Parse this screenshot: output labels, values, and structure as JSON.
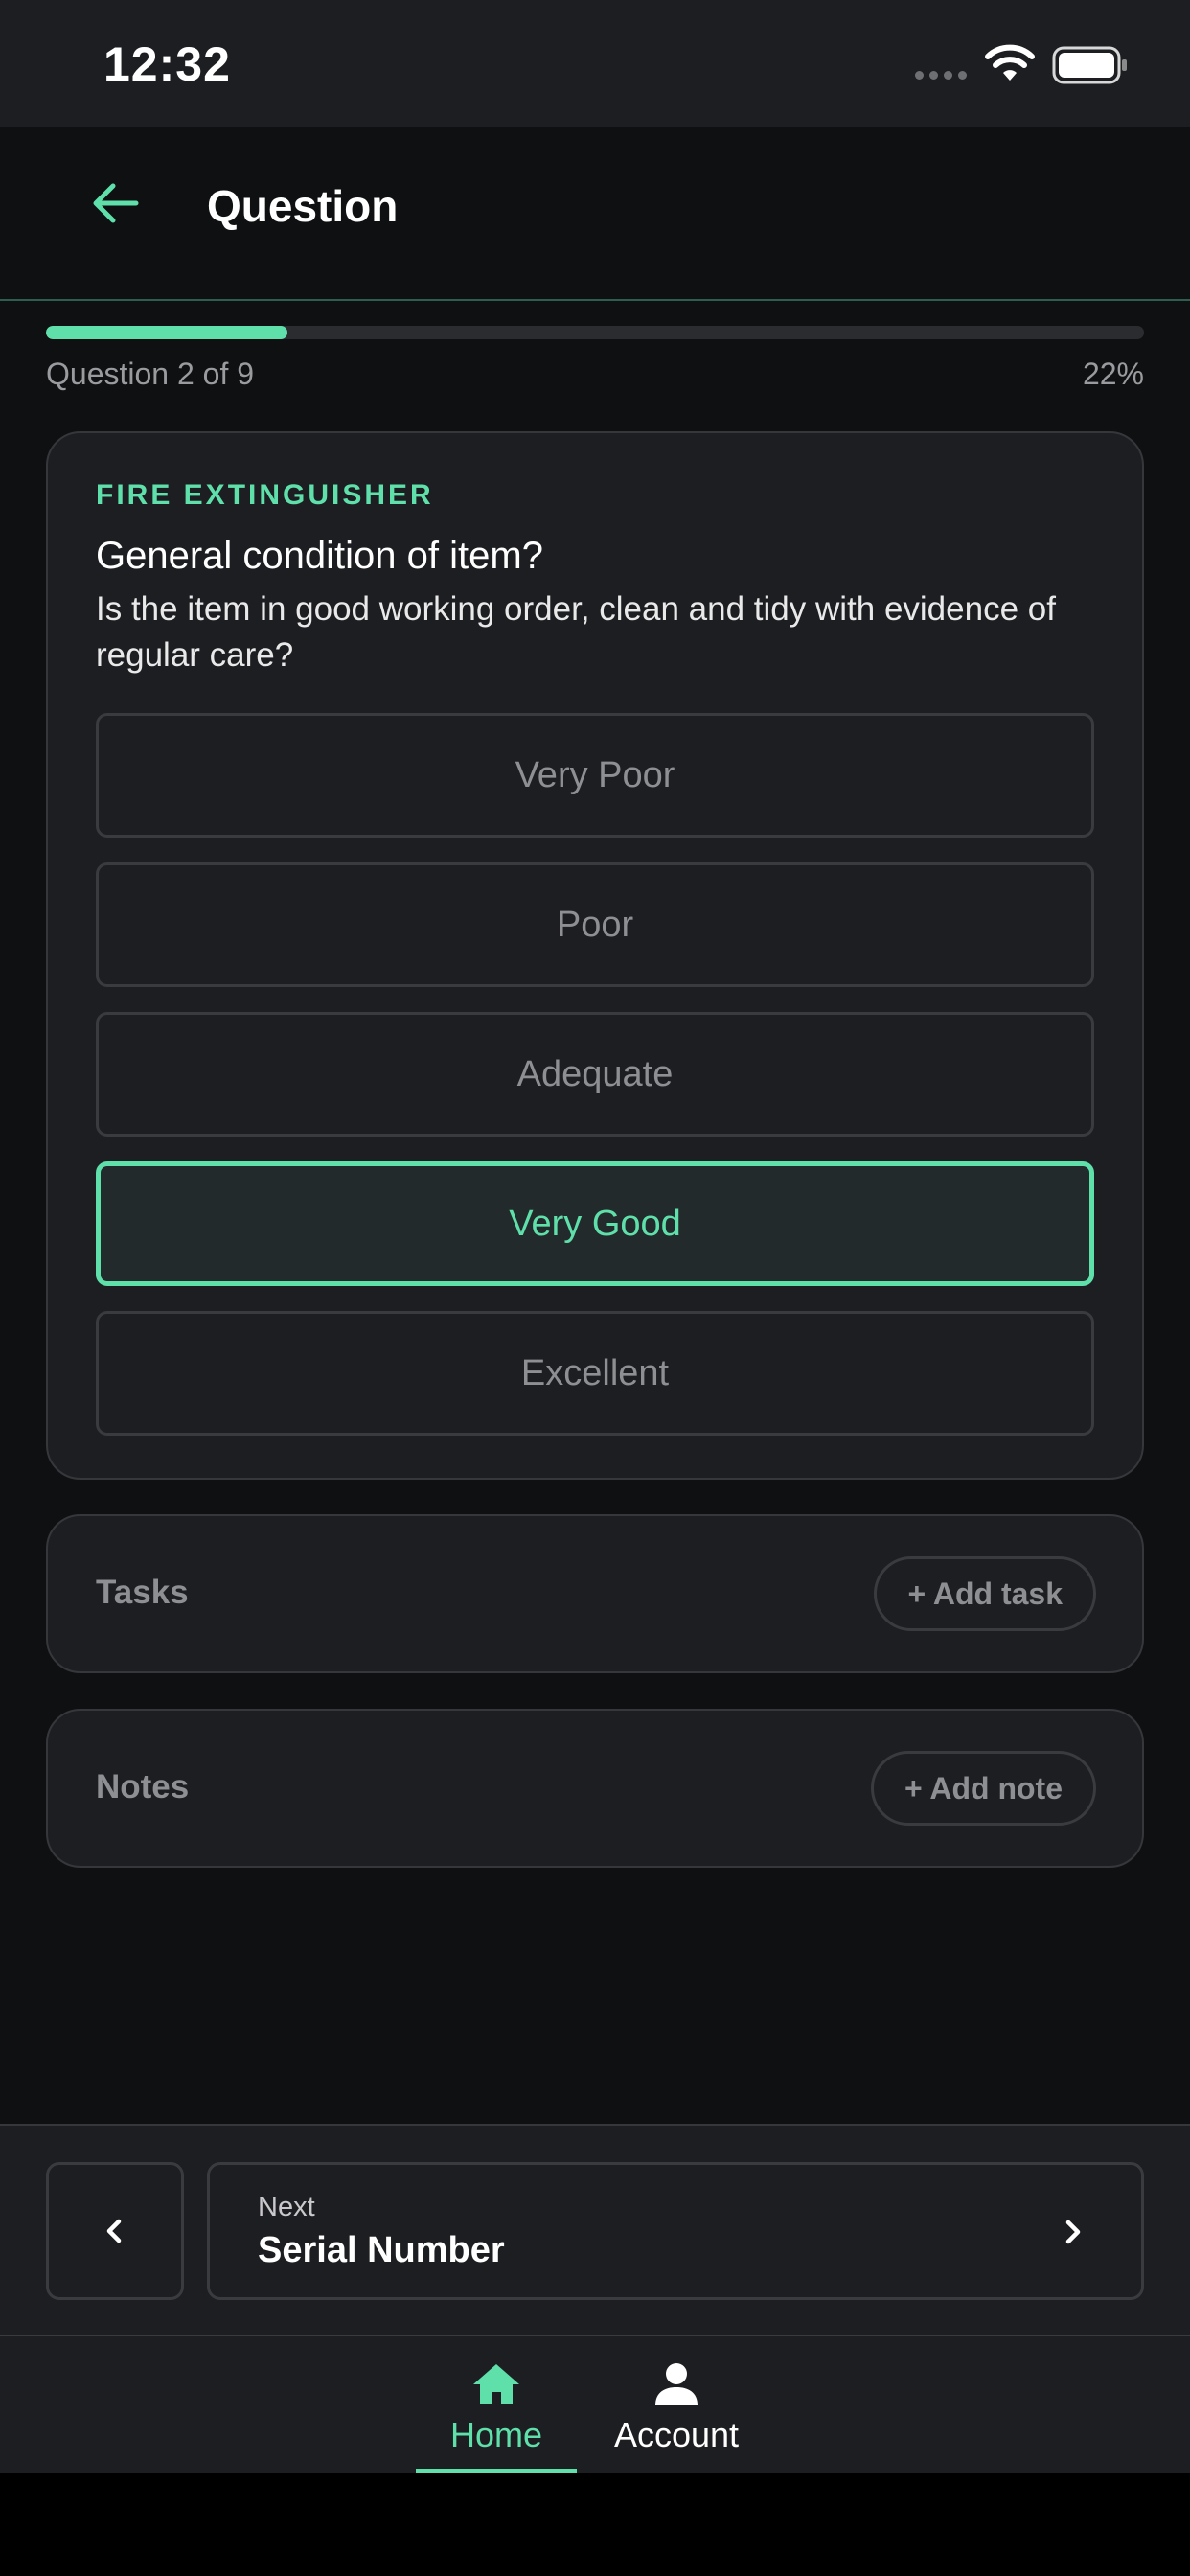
{
  "status_bar": {
    "time": "12:32"
  },
  "header": {
    "title": "Question"
  },
  "progress": {
    "label": "Question 2 of 9",
    "percent_text": "22%",
    "fraction": 0.22
  },
  "question": {
    "category": "FIRE EXTINGUISHER",
    "title": "General condition of item?",
    "description": "Is the item in good working order, clean and tidy with evidence of regular care?",
    "options": [
      {
        "label": "Very Poor",
        "selected": false
      },
      {
        "label": "Poor",
        "selected": false
      },
      {
        "label": "Adequate",
        "selected": false
      },
      {
        "label": "Very Good",
        "selected": true
      },
      {
        "label": "Excellent",
        "selected": false
      }
    ]
  },
  "tasks": {
    "label": "Tasks",
    "add_label": "+ Add task"
  },
  "notes": {
    "label": "Notes",
    "add_label": "+ Add note"
  },
  "navigation": {
    "next_caption": "Next",
    "next_title": "Serial Number"
  },
  "tab_bar": {
    "items": [
      {
        "label": "Home",
        "icon": "home-icon",
        "active": true
      },
      {
        "label": "Account",
        "icon": "person-icon",
        "active": false
      }
    ]
  },
  "colors": {
    "accent": "#5fe0ab",
    "background": "#0f1012",
    "surface": "#1d1e21",
    "border": "#3a3b3e",
    "muted_text": "#8e8f92"
  }
}
